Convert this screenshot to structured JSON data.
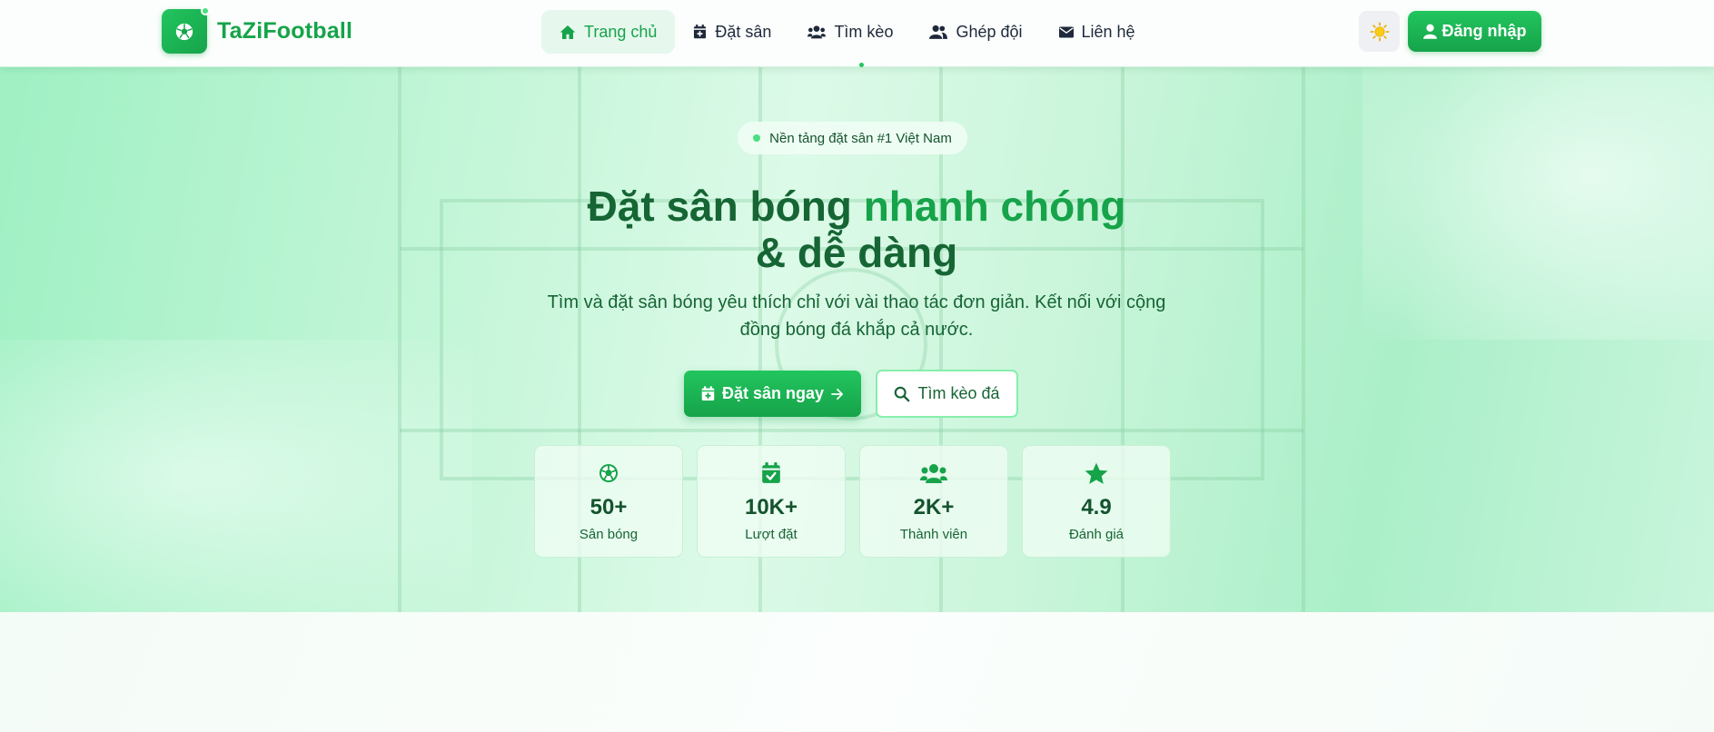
{
  "brand": {
    "name": "TaZiFootball",
    "logo_icon": "soccer-ball-icon"
  },
  "nav": {
    "items": [
      {
        "label": "Trang chủ",
        "icon": "home-icon",
        "active": true
      },
      {
        "label": "Đặt sân",
        "icon": "calendar-plus-icon",
        "active": false
      },
      {
        "label": "Tìm kèo",
        "icon": "users-icon",
        "active": false
      },
      {
        "label": "Ghép đội",
        "icon": "user-group-icon",
        "active": false
      },
      {
        "label": "Liên hệ",
        "icon": "envelope-icon",
        "active": false
      }
    ],
    "theme_toggle_icon": "sun-icon",
    "login_label": "Đăng nhập"
  },
  "hero": {
    "badge": "Nền tảng đặt sân #1 Việt Nam",
    "headline_part1": "Đặt sân bóng ",
    "headline_accent": "nhanh chóng",
    "headline_part2": "& dễ dàng",
    "subtitle": "Tìm và đặt sân bóng yêu thích chỉ với vài thao tác đơn giản. Kết nối với cộng đồng bóng đá khắp cả nước.",
    "primary_button": "Đặt sân ngay",
    "secondary_button": "Tìm kèo đá"
  },
  "stats": [
    {
      "value": "50+",
      "label": "Sân bóng",
      "icon": "soccer-ball-icon"
    },
    {
      "value": "10K+",
      "label": "Lượt đặt",
      "icon": "calendar-check-icon"
    },
    {
      "value": "2K+",
      "label": "Thành viên",
      "icon": "users-icon"
    },
    {
      "value": "4.9",
      "label": "Đánh giá",
      "icon": "star-icon"
    }
  ],
  "colors": {
    "brand_green": "#16a34a",
    "accent_green": "#22c55e",
    "dark_green": "#166534",
    "sun_yellow": "#facc15"
  }
}
